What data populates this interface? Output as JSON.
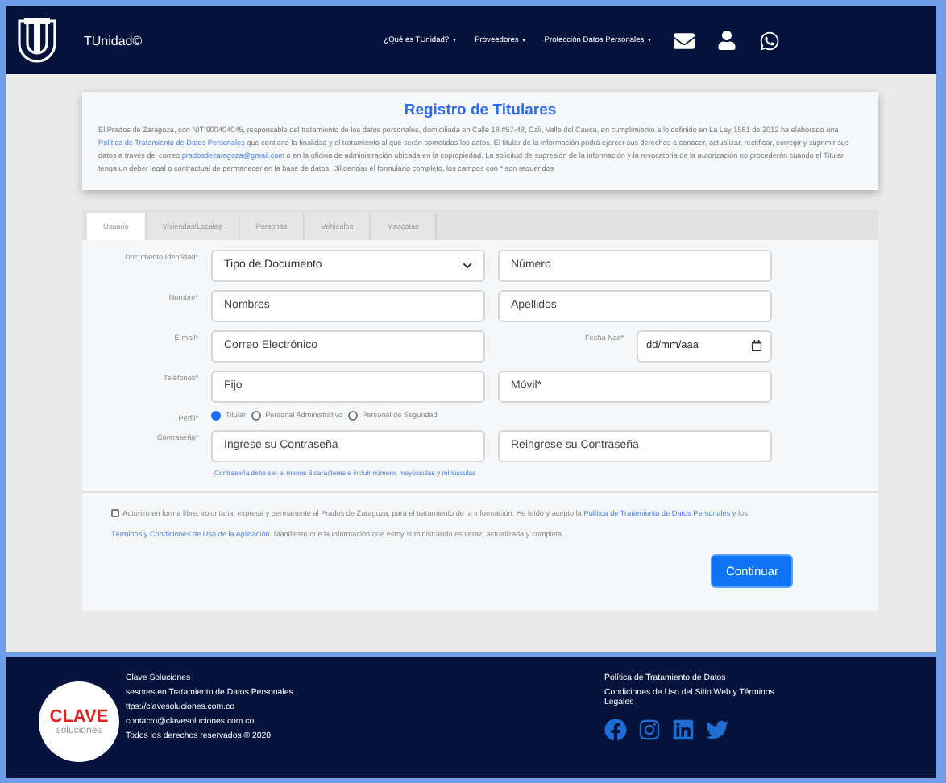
{
  "header": {
    "brand": "TUnidad©",
    "nav": [
      {
        "label": "¿Qué es TUnidad?"
      },
      {
        "label": "Proveedores"
      },
      {
        "label": "Protección Datos Personales"
      }
    ]
  },
  "intro": {
    "title": "Registro de Titulares",
    "parts": [
      {
        "kind": "text",
        "text": "El Prados de Zaragoza, con NIT 900404045, responsable del tratamiento de los datos personales, domiciliada en Calle 18 #57-48, Cali, Valle del Cauca, en cumplimiento a lo definido en La Ley 1581 de 2012 ha elaborado una "
      },
      {
        "kind": "link",
        "text": "Política de Tratamiento de Datos Personales"
      },
      {
        "kind": "text",
        "text": " que contiene la finalidad y el tratamiento al que serán sometidos los datos. El titular de la información podrá ejercer sus derechos a conocer, actualizar, rectificar, corregir y suprimir sus datos a través del correo "
      },
      {
        "kind": "link",
        "text": "pradosdezaragoza@gmail.com"
      },
      {
        "kind": "text",
        "text": " o en la oficina de administración ubicada en la copropiedad. La solicitud de supresión de la información y la revocatoria de la autorización no procederán cuando el Titular tenga un deber legal o contractual de permanecer en la base de datos. Diligenciar el formulario completo, los campos con * son requeridos"
      }
    ]
  },
  "tabs": [
    {
      "label": "Usuario",
      "selected": true
    },
    {
      "label": "Viviendas/Locales",
      "selected": false
    },
    {
      "label": "Personas",
      "selected": false
    },
    {
      "label": "Vehículos",
      "selected": false
    },
    {
      "label": "Mascotas",
      "selected": false
    }
  ],
  "form": {
    "rows": [
      {
        "kind": "pair",
        "label": "Documento Identidad*",
        "fields": [
          {
            "kind": "select",
            "value": "Tipo de Documento"
          },
          {
            "kind": "input",
            "placeholder": "Número"
          }
        ]
      },
      {
        "kind": "pair",
        "label": "Nombre*",
        "fields": [
          {
            "kind": "input",
            "placeholder": "Nombres"
          },
          {
            "kind": "input",
            "placeholder": "Apellidos"
          }
        ]
      },
      {
        "kind": "date",
        "label": "E-mail*",
        "fields": [
          {
            "kind": "input",
            "placeholder": "Correo Electrónico"
          },
          {
            "kind": "date",
            "label": "Fecha Nac*",
            "value": "dd/mm/aaa"
          }
        ]
      },
      {
        "kind": "pair",
        "label": "Teléfonos*",
        "fields": [
          {
            "kind": "input",
            "placeholder": "Fijo"
          },
          {
            "kind": "input",
            "placeholder": "Móvil*"
          }
        ]
      },
      {
        "kind": "radio",
        "label": "Perfil*",
        "options": [
          {
            "label": "Titular",
            "selected": true
          },
          {
            "label": "Personal Administrativo",
            "selected": false
          },
          {
            "label": "Personal de Seguridad",
            "selected": false
          }
        ]
      },
      {
        "kind": "pair",
        "label": "Contraseña*",
        "fields": [
          {
            "kind": "input",
            "placeholder": "Ingrese su Contraseña"
          },
          {
            "kind": "input",
            "placeholder": "Reingrese su Contraseña"
          }
        ]
      }
    ],
    "hint": "Contraseña debe ser al menos 8 caracteres e incluir número, mayúsculas y minúsculas",
    "consent": {
      "checked": false,
      "parts": [
        {
          "kind": "text",
          "text": "Autorizo en forma libre, voluntaria, expresa y permanente al Prados de Zaragoza, para el tratamiento de la información. He leído y acepto la "
        },
        {
          "kind": "link",
          "text": "Política de Tratamiento de Datos Personales"
        },
        {
          "kind": "text",
          "text": " y los "
        },
        {
          "kind": "link",
          "text": "Términos y Condiciones de Uso de la Aplicación"
        },
        {
          "kind": "text",
          "text": ". Manifiesto que la información que estoy suministrando es veraz, actualizada y completa."
        }
      ]
    },
    "submit": "Continuar"
  },
  "footer": {
    "logo": {
      "name": "CLAVE",
      "tagline": "soluciones"
    },
    "lines": [
      "Clave Soluciones",
      "sesores en Tratamiento de Datos Personales",
      "ttps://clavesoluciones.com.co",
      "contacto@clavesoluciones.com.co",
      "Todos los derechos reservados © 2020"
    ],
    "links": [
      "Política de Tratamiento de Datos",
      "Condiciones de Uso del Sitio Web y Términos Legales"
    ],
    "social": [
      {
        "kind": "facebook"
      },
      {
        "kind": "instagram"
      },
      {
        "kind": "linkedin"
      },
      {
        "kind": "twitter"
      }
    ]
  }
}
